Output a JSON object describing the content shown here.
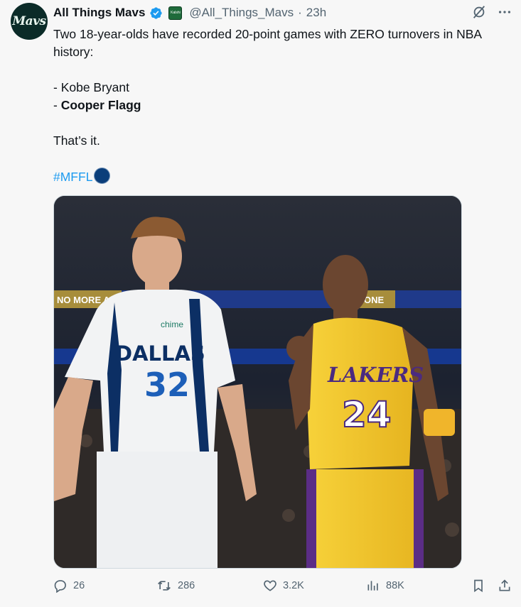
{
  "account": {
    "display_name": "All Things Mavs",
    "handle": "@All_Things_Mavs",
    "separator": "·",
    "time": "23h",
    "avatar_text": "Mavs",
    "affiliate_badge_text": "Kalshi"
  },
  "tweet": {
    "line1": "Two 18-year-olds have recorded 20-point games with ZERO turnovers in NBA history:",
    "item1": "- Kobe Bryant",
    "item2_prefix": "- ",
    "item2_name": "Cooper Flagg",
    "closing": "That’s it.",
    "hashtag": "#MFFL"
  },
  "media": {
    "left_jersey_team": "DALLAS",
    "left_jersey_number": "32",
    "left_patch": "chime",
    "right_jersey_team": "LAKERS",
    "right_jersey_number": "24",
    "arena_banner_left": "NO MORE AL",
    "arena_banner_right": "ONE"
  },
  "actions": {
    "replies": "26",
    "reposts": "286",
    "likes": "3.2K",
    "views": "88K"
  },
  "icons": {
    "verified": "verified-badge-icon",
    "grok": "grok-icon",
    "more": "more-icon",
    "reply": "reply-icon",
    "repost": "repost-icon",
    "like": "heart-icon",
    "views": "views-icon",
    "bookmark": "bookmark-icon",
    "share": "share-icon"
  },
  "colors": {
    "accent": "#1d9bf0",
    "muted": "#536471",
    "mavs_green": "#0b2b28",
    "lakers_gold": "#f4c430",
    "mavs_navy": "#0b3e7a"
  }
}
